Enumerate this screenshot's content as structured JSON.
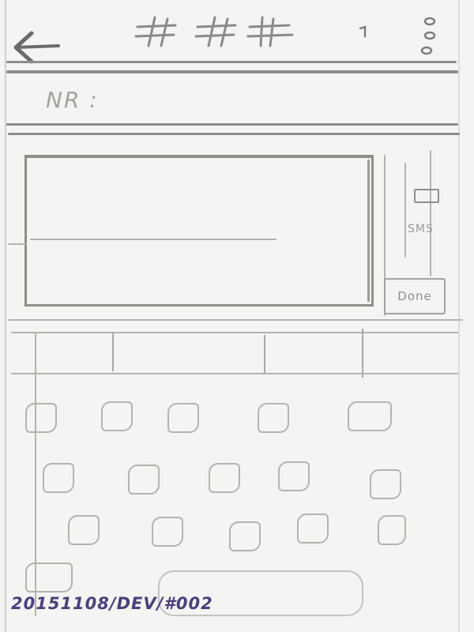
{
  "appbar": {
    "back_icon": "arrow-left-icon",
    "title_marks": "# # #",
    "status_icon": "signal-icon",
    "overflow_icon": "more-vertical-icon"
  },
  "recipient": {
    "label": "NR :"
  },
  "composer": {
    "sms_icon": "message-icon",
    "sms_label": "SMS",
    "done_label": "Done"
  },
  "keyboard": {
    "suggestion_slots": 4,
    "rows": [
      5,
      5,
      5
    ],
    "key_icon": "key-glyph-icon"
  },
  "footer": {
    "caption": "20151108/DEV/#002"
  },
  "colors": {
    "pencil": "#8d8d8b",
    "paper": "#f4f4f2",
    "ink": "#4d3f7d"
  }
}
